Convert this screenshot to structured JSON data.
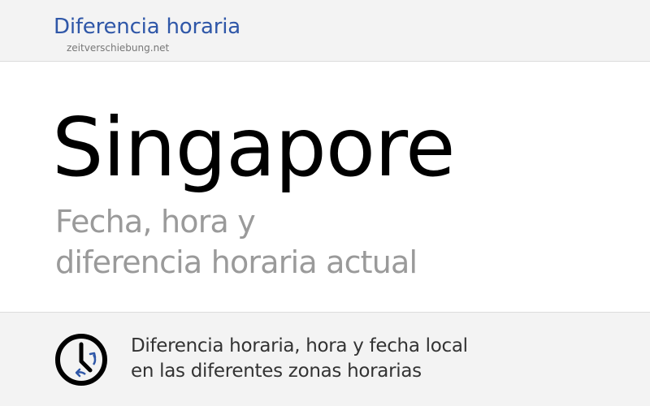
{
  "header": {
    "title": "Diferencia horaria",
    "site": "zeitverschiebung.net"
  },
  "hero": {
    "city": "Singapore",
    "subtitle_line1": "Fecha, hora y",
    "subtitle_line2": "diferencia horaria actual"
  },
  "footer": {
    "icon": "clock-icon",
    "line1": "Diferencia horaria, hora y fecha local",
    "line2": "en las diferentes zonas horarias"
  },
  "colors": {
    "brand": "#2f57a8",
    "header_bg": "#f3f3f3",
    "subtitle": "#9a9a9a",
    "footer_bg": "#f3f3f3"
  }
}
